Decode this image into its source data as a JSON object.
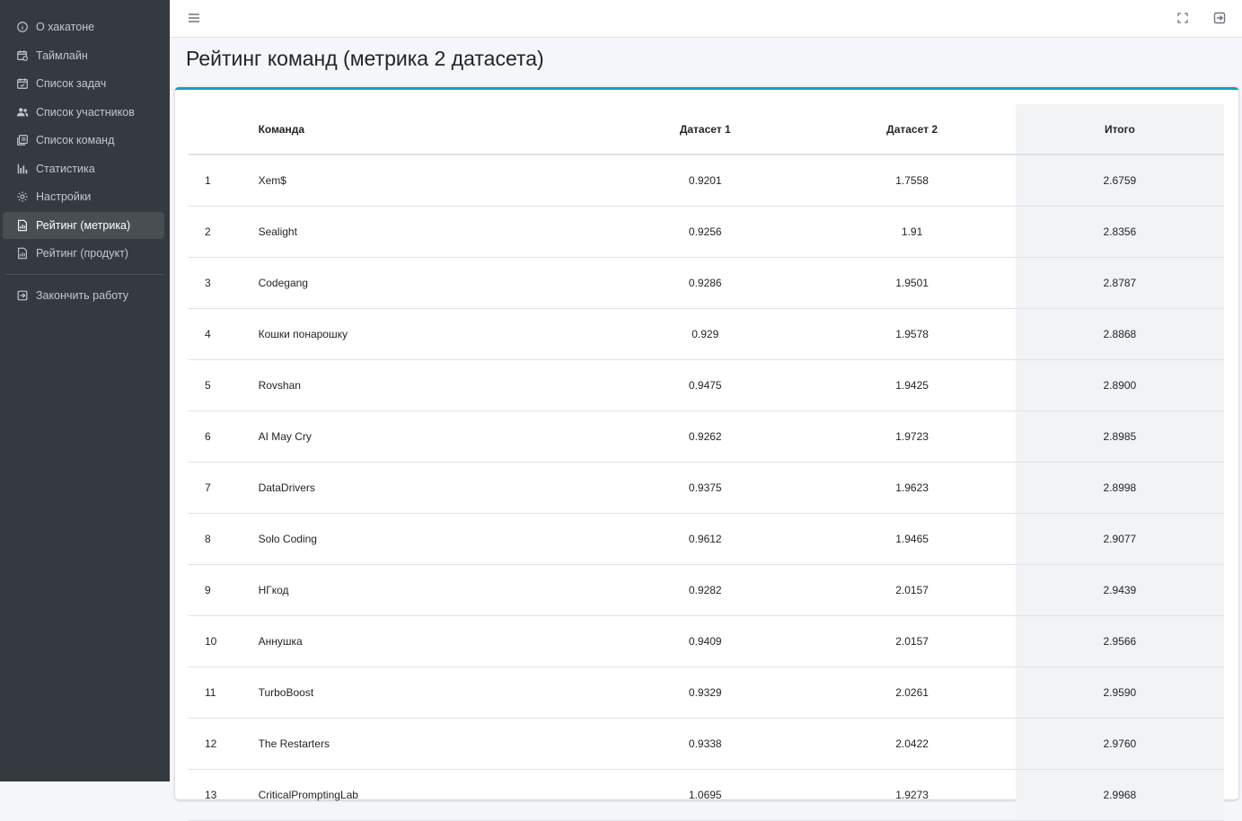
{
  "sidebar": {
    "items": [
      {
        "label": "О хакатоне",
        "icon": "info-circle-icon",
        "active": false
      },
      {
        "label": "Таймлайн",
        "icon": "calendar-clock-icon",
        "active": false
      },
      {
        "label": "Список задач",
        "icon": "calendar-check-icon",
        "active": false
      },
      {
        "label": "Список участников",
        "icon": "users-icon",
        "active": false
      },
      {
        "label": "Список команд",
        "icon": "team-list-icon",
        "active": false
      },
      {
        "label": "Статистика",
        "icon": "bar-chart-icon",
        "active": false
      },
      {
        "label": "Настройки",
        "icon": "gear-icon",
        "active": false
      },
      {
        "label": "Рейтинг (метрика)",
        "icon": "report-icon",
        "active": true
      },
      {
        "label": "Рейтинг (продукт)",
        "icon": "report-icon",
        "active": false
      }
    ],
    "logout_label": "Закончить работу"
  },
  "header": {
    "menu_icon": "hamburger-icon",
    "fullscreen_icon": "fullscreen-icon",
    "exit_icon": "exit-icon"
  },
  "page": {
    "title": "Рейтинг команд (метрика 2 датасета)"
  },
  "table": {
    "headers": {
      "rank": "",
      "team": "Команда",
      "d1": "Датасет 1",
      "d2": "Датасет 2",
      "total": "Итого"
    },
    "rows": [
      {
        "rank": "1",
        "team": "Xem$",
        "d1": "0.9201",
        "d2": "1.7558",
        "total": "2.6759"
      },
      {
        "rank": "2",
        "team": "Sealight",
        "d1": "0.9256",
        "d2": "1.91",
        "total": "2.8356"
      },
      {
        "rank": "3",
        "team": "Codegang",
        "d1": "0.9286",
        "d2": "1.9501",
        "total": "2.8787"
      },
      {
        "rank": "4",
        "team": "Кошки понарошку",
        "d1": "0.929",
        "d2": "1.9578",
        "total": "2.8868"
      },
      {
        "rank": "5",
        "team": "Rovshan",
        "d1": "0.9475",
        "d2": "1.9425",
        "total": "2.8900"
      },
      {
        "rank": "6",
        "team": "AI May Cry",
        "d1": "0.9262",
        "d2": "1.9723",
        "total": "2.8985"
      },
      {
        "rank": "7",
        "team": "DataDrivers",
        "d1": "0.9375",
        "d2": "1.9623",
        "total": "2.8998"
      },
      {
        "rank": "8",
        "team": "Solo Coding",
        "d1": "0.9612",
        "d2": "1.9465",
        "total": "2.9077"
      },
      {
        "rank": "9",
        "team": "НГкод",
        "d1": "0.9282",
        "d2": "2.0157",
        "total": "2.9439"
      },
      {
        "rank": "10",
        "team": "Аннушка",
        "d1": "0.9409",
        "d2": "2.0157",
        "total": "2.9566"
      },
      {
        "rank": "11",
        "team": "TurboBoost",
        "d1": "0.9329",
        "d2": "2.0261",
        "total": "2.9590"
      },
      {
        "rank": "12",
        "team": "The Restarters",
        "d1": "0.9338",
        "d2": "2.0422",
        "total": "2.9760"
      },
      {
        "rank": "13",
        "team": "CriticalPromptingLab",
        "d1": "1.0695",
        "d2": "1.9273",
        "total": "2.9968"
      }
    ]
  },
  "colors": {
    "sidebar_bg": "#343a40",
    "sidebar_text": "#c2c7d0",
    "active_item_bg": "#494e53",
    "card_accent": "#17a2b8",
    "total_column_bg": "#f2f3f4"
  }
}
